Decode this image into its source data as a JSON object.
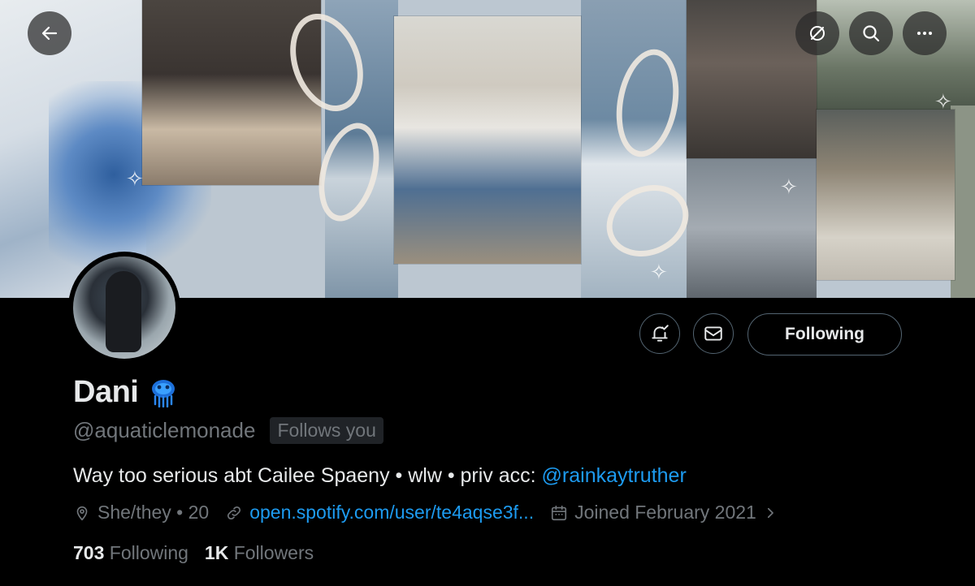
{
  "top_bar": {
    "back_icon": "arrow-left-icon",
    "notifications_off_icon": "bell-slash-icon",
    "search_icon": "search-icon",
    "more_icon": "ellipsis-icon"
  },
  "actions": {
    "notify_icon": "bell-plus-icon",
    "message_icon": "envelope-icon",
    "following_label": "Following"
  },
  "profile": {
    "display_name": "Dani",
    "name_emoji": "jellyfish",
    "handle": "@aquaticlemonade",
    "follows_you": "Follows you",
    "bio_text": "Way too serious abt Cailee Spaeny • wlw • priv acc: ",
    "bio_mention": "@rainkaytruther",
    "location": "She/they • 20",
    "website": "open.spotify.com/user/te4aqse3f...",
    "joined": "Joined February 2021"
  },
  "stats": {
    "following_count": "703",
    "following_label": "Following",
    "followers_count": "1K",
    "followers_label": "Followers"
  },
  "colors": {
    "accent": "#1d9bf0",
    "muted": "#71767b",
    "text": "#e7e9ea",
    "background": "#000000"
  }
}
